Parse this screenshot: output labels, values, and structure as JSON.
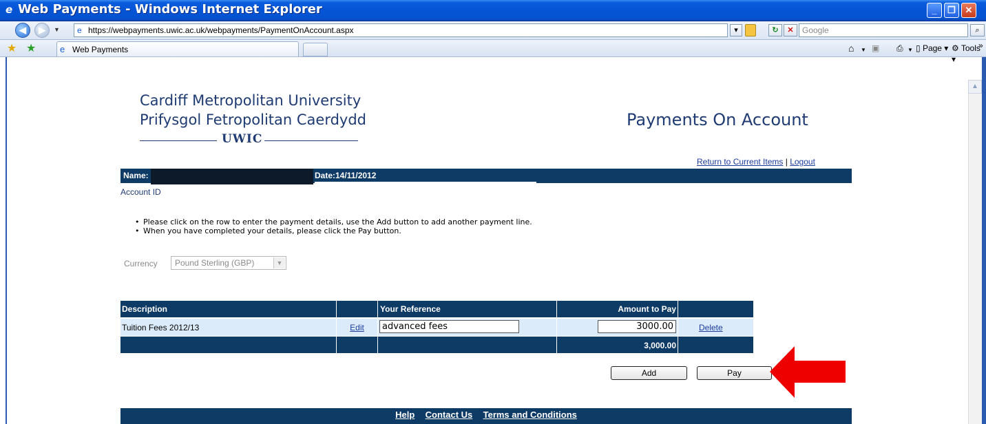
{
  "window": {
    "title": "Web Payments - Windows Internet Explorer",
    "ie_icon": "ie-logo-icon",
    "controls": [
      "minimize",
      "maximize",
      "close"
    ]
  },
  "navbar": {
    "url": "https://webpayments.uwic.ac.uk/webpayments/PaymentOnAccount.aspx",
    "search_placeholder": "Google"
  },
  "tabs": {
    "active_label": "Web Payments"
  },
  "commandbar": {
    "page_label": "Page",
    "tools_label": "Tools"
  },
  "page": {
    "university_en": "Cardiff Metropolitan University",
    "university_cy": "Prifysgol Fetropolitan Caerdydd",
    "logo_text": "UWIC",
    "title": "Payments On Account",
    "links": {
      "return": "Return to Current Items",
      "separator": "|",
      "logout": "Logout"
    },
    "infobar": {
      "name_label": "Name:",
      "date_label": "Date:14/11/2012"
    },
    "account_id_label": "Account ID",
    "instructions": [
      "Please click on the row to enter the payment details, use the Add button to add another payment line.",
      "When you have completed your details, please click the Pay button."
    ],
    "currency": {
      "label": "Currency",
      "value": "Pound Sterling (GBP)"
    },
    "table": {
      "headers": {
        "description": "Description",
        "edit": "",
        "reference": "Your Reference",
        "amount": "Amount to Pay",
        "action": ""
      },
      "rows": [
        {
          "description": "Tuition Fees 2012/13",
          "edit": "Edit",
          "reference": "advanced fees",
          "amount": "3000.00",
          "delete": "Delete"
        }
      ],
      "total": "3,000.00"
    },
    "buttons": {
      "add": "Add",
      "pay": "Pay"
    },
    "footer": {
      "help": "Help",
      "contact": "Contact Us",
      "terms": "Terms and Conditions"
    }
  },
  "colors": {
    "navy": "#0e3a66",
    "row_bg": "#dcebf9",
    "arrow": "#ee0000",
    "titlebar": "#0554d6"
  }
}
